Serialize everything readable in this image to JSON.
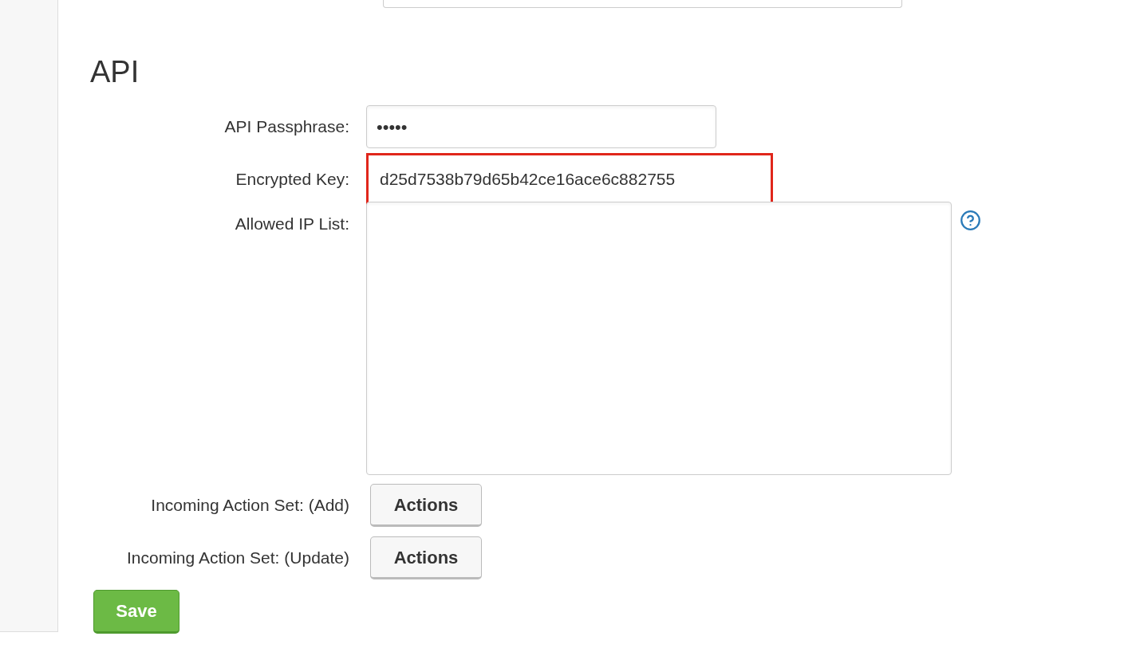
{
  "section": {
    "title": "API"
  },
  "fields": [
    {
      "kind": "password",
      "label": "API Passphrase:",
      "value": "•••••"
    },
    {
      "kind": "readonly",
      "label": "Encrypted Key:",
      "value": "d25d7538b79d65b42ce16ace6c882755",
      "highlighted": true
    },
    {
      "kind": "textarea",
      "label": "Allowed IP List:",
      "help": true
    },
    {
      "kind": "button",
      "label": "Incoming Action Set: (Add)",
      "button": "Actions"
    },
    {
      "kind": "button",
      "label": "Incoming Action Set: (Update)",
      "button": "Actions"
    }
  ],
  "save_button": "Save"
}
